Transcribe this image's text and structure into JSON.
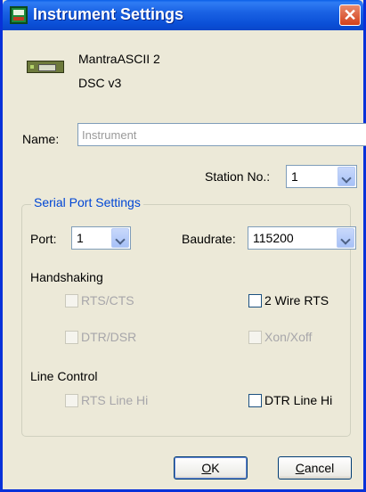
{
  "window": {
    "title": "Instrument Settings",
    "close_glyph": "✕"
  },
  "device": {
    "line1": "MantraASCII 2",
    "line2": "DSC v3",
    "icon": "instrument-device-icon"
  },
  "name_field": {
    "label": "Name:",
    "placeholder": "Instrument"
  },
  "station": {
    "label": "Station No.:",
    "value": "1"
  },
  "serial": {
    "title": "Serial Port Settings",
    "port": {
      "label": "Port:",
      "value": "1"
    },
    "baudrate": {
      "label": "Baudrate:",
      "value": "115200"
    },
    "handshaking": {
      "title": "Handshaking",
      "rts_cts": {
        "label": "RTS/CTS",
        "enabled": false,
        "checked": false
      },
      "two_wire_rts": {
        "label": "2 Wire RTS",
        "enabled": true,
        "checked": false
      },
      "dtr_dsr": {
        "label": "DTR/DSR",
        "enabled": false,
        "checked": false
      },
      "xon_xoff": {
        "label": "Xon/Xoff",
        "enabled": false,
        "checked": false
      }
    },
    "line_control": {
      "title": "Line Control",
      "rts_line_hi": {
        "label": "RTS Line Hi",
        "enabled": false,
        "checked": false
      },
      "dtr_line_hi": {
        "label": "DTR Line Hi",
        "enabled": true,
        "checked": false
      }
    }
  },
  "buttons": {
    "ok": "OK",
    "cancel": "Cancel"
  },
  "colors": {
    "titlebar": "#0a4fd6",
    "group_title": "#0046d5",
    "dialog_bg": "#ece9d8"
  }
}
